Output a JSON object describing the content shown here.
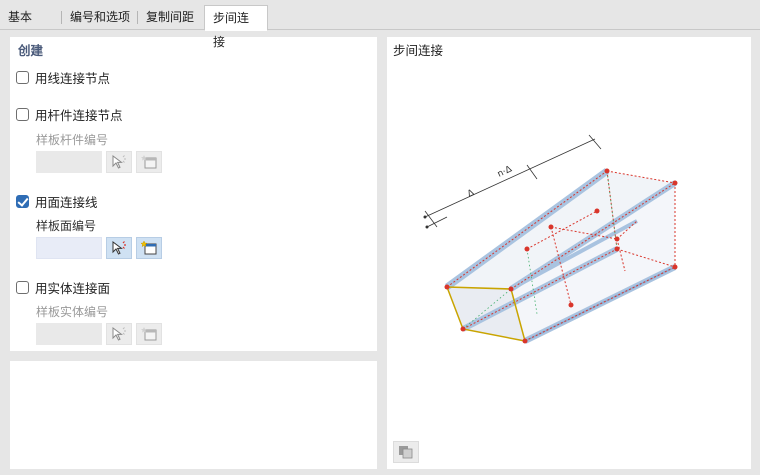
{
  "tabs": [
    {
      "label": "基本",
      "active": false
    },
    {
      "label": "编号和选项",
      "active": false
    },
    {
      "label": "复制间距",
      "active": false
    },
    {
      "label": "步间连接",
      "active": true
    }
  ],
  "create": {
    "title": "创建",
    "options": [
      {
        "label": "用线连接节点",
        "checked": false
      },
      {
        "label": "用杆件连接节点",
        "checked": false,
        "sub_label": "样板杆件编号"
      },
      {
        "label": "用面连接线",
        "checked": true,
        "sub_label": "样板面编号"
      },
      {
        "label": "用实体连接面",
        "checked": false,
        "sub_label": "样板实体编号"
      }
    ]
  },
  "preview": {
    "title": "步间连接",
    "dim_labels": [
      "Δ",
      "n·Δ"
    ]
  },
  "icons": {
    "pick": "pick-arrow-icon",
    "select_list": "select-list-icon",
    "view": "view-cube-icon"
  },
  "colors": {
    "accent": "#2f6db5",
    "title": "#4a5a7a",
    "edge_red": "#d9352b",
    "edge_yellow": "#c9a400",
    "member_blue": "#a9c3e0"
  }
}
